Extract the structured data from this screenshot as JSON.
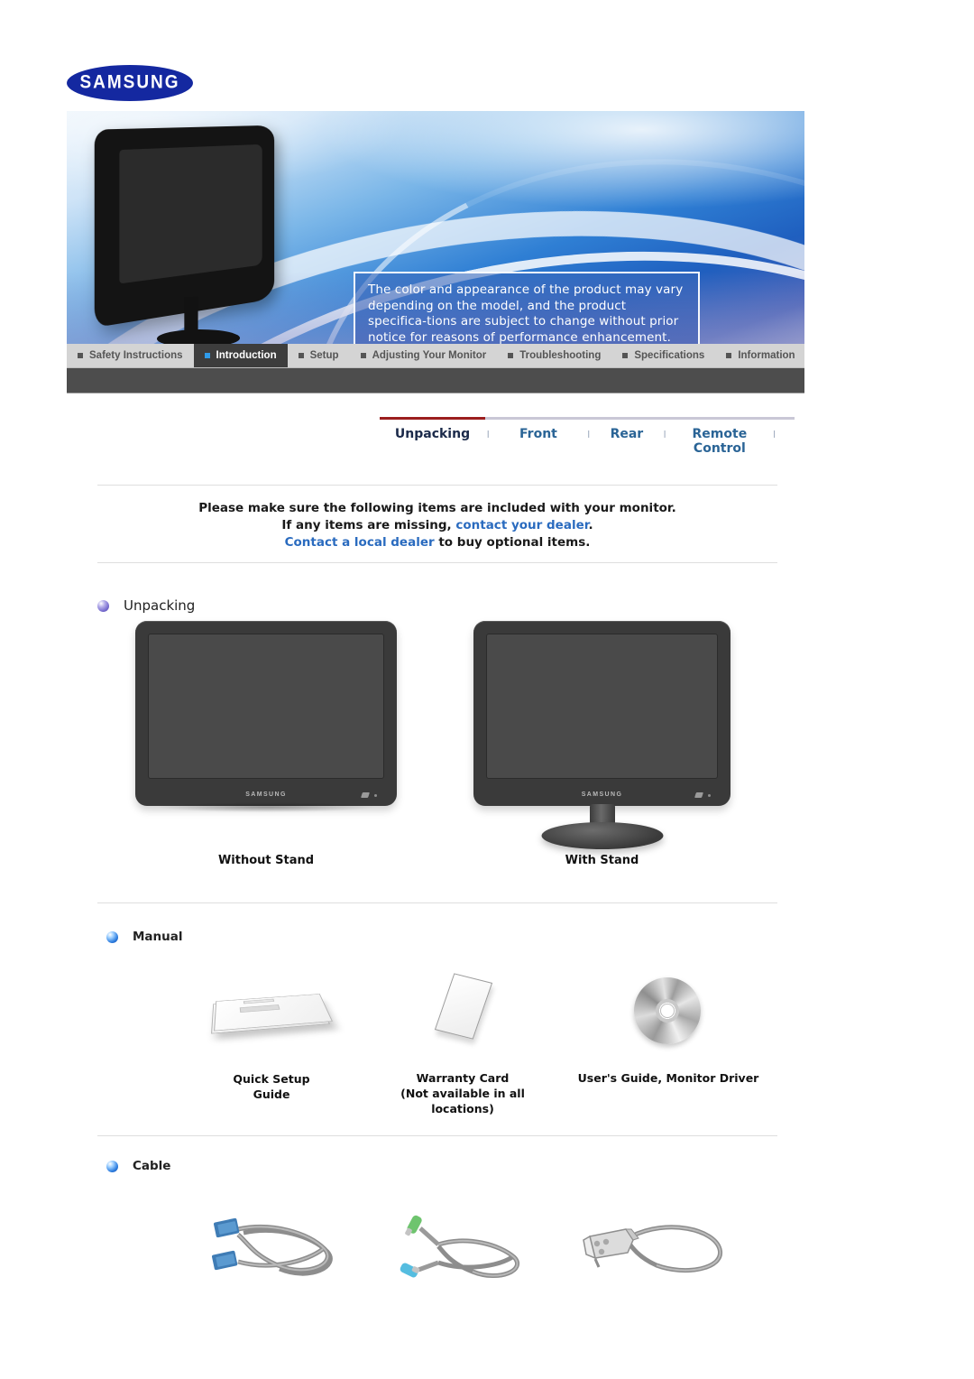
{
  "brand": {
    "logo_text": "SAMSUNG"
  },
  "hero": {
    "note": "The color and appearance of the product may vary depending on the model, and the product specifica-tions are subject to change without prior notice for reasons of performance enhancement."
  },
  "main_nav": {
    "items": [
      {
        "label": "Safety Instructions",
        "active": false
      },
      {
        "label": "Introduction",
        "active": true
      },
      {
        "label": "Setup",
        "active": false
      },
      {
        "label": "Adjusting Your Monitor",
        "active": false
      },
      {
        "label": "Troubleshooting",
        "active": false
      },
      {
        "label": "Specifications",
        "active": false
      },
      {
        "label": "Information",
        "active": false
      }
    ]
  },
  "section_tabs": {
    "separator": "l",
    "items": [
      {
        "label": "Unpacking",
        "active": true
      },
      {
        "label": "Front",
        "active": false
      },
      {
        "label": "Rear",
        "active": false
      },
      {
        "label": "Remote Control",
        "active": false
      }
    ]
  },
  "intro": {
    "line1": "Please make sure the following items are included with your monitor.",
    "line2_a": "If any items are missing, ",
    "line2_b": "contact your dealer",
    "line2_c": ".",
    "line3_a": "Contact a local dealer",
    "line3_b": " to buy optional items."
  },
  "sections": {
    "unpacking": {
      "title": "Unpacking",
      "figures": [
        {
          "label": "Without Stand"
        },
        {
          "label": "With Stand"
        }
      ],
      "monitor_brand": "SAMSUNG"
    },
    "manual": {
      "title": "Manual",
      "items": [
        {
          "name": "Quick Setup Guide",
          "sub": ""
        },
        {
          "name": "Warranty Card",
          "sub": "(Not available in all locations)"
        },
        {
          "name": "User's Guide, Monitor Driver",
          "sub": ""
        }
      ]
    },
    "cable": {
      "title": "Cable",
      "items": [
        {
          "icon": "d-sub-cable-icon"
        },
        {
          "icon": "audio-cable-icon"
        },
        {
          "icon": "power-cord-icon"
        }
      ]
    }
  },
  "colors": {
    "brand_blue": "#1428a0",
    "link_blue": "#2a6bbf",
    "tab_blue": "#2a6496",
    "tab_active": "#1b2a4a",
    "accent_red": "#9b1e1e",
    "nav_bg": "#d4d4d4",
    "nav_active_bg": "#3d3d3d",
    "subbar_bg": "#4d4d4d"
  }
}
